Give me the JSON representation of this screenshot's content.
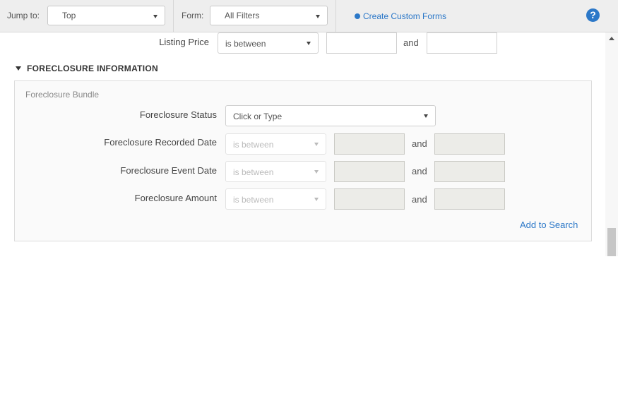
{
  "toolbar": {
    "jump_label": "Jump to:",
    "jump_value": "Top",
    "form_label": "Form:",
    "form_value": "All Filters",
    "create_label": "Create Custom Forms",
    "help_glyph": "?"
  },
  "listing": {
    "label": "Listing Price",
    "operator": "is between",
    "and": "and"
  },
  "section": {
    "title": "FORECLOSURE INFORMATION"
  },
  "bundle": {
    "title": "Foreclosure Bundle",
    "status_label": "Foreclosure Status",
    "status_placeholder": "Click or Type",
    "rows": [
      {
        "label": "Foreclosure Recorded Date",
        "operator": "is between",
        "and": "and"
      },
      {
        "label": "Foreclosure Event Date",
        "operator": "is between",
        "and": "and"
      },
      {
        "label": "Foreclosure Amount",
        "operator": "is between",
        "and": "and"
      }
    ],
    "add_label": "Add to Search"
  }
}
